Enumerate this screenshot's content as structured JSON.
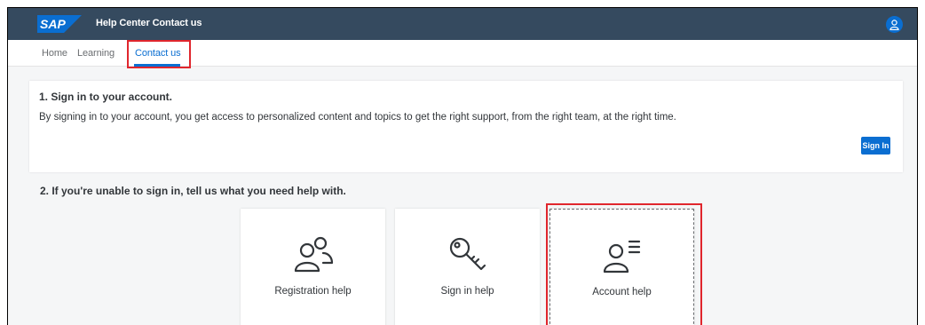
{
  "shell": {
    "logo_text": "SAP",
    "title": "Help Center Contact us",
    "colors": {
      "shellbar": "#354a5f",
      "accent": "#0a6ed1",
      "highlight": "#e0262d"
    }
  },
  "tabs": [
    {
      "label": "Home"
    },
    {
      "label": "Learning"
    },
    {
      "label": "Contact us",
      "selected": true
    }
  ],
  "signin": {
    "title": "1. Sign in to your account.",
    "description": "By signing in to your account, you get access to personalized content and topics to get the right support, from the right team, at the right time.",
    "button_label": "Sign In"
  },
  "help_section": {
    "title": "2. If you're unable to sign in, tell us what you need help with.",
    "tiles": [
      {
        "label": "Registration help",
        "icon": "users-icon"
      },
      {
        "label": "Sign in help",
        "icon": "key-icon"
      },
      {
        "label": "Account help",
        "icon": "user-list-icon"
      }
    ]
  }
}
